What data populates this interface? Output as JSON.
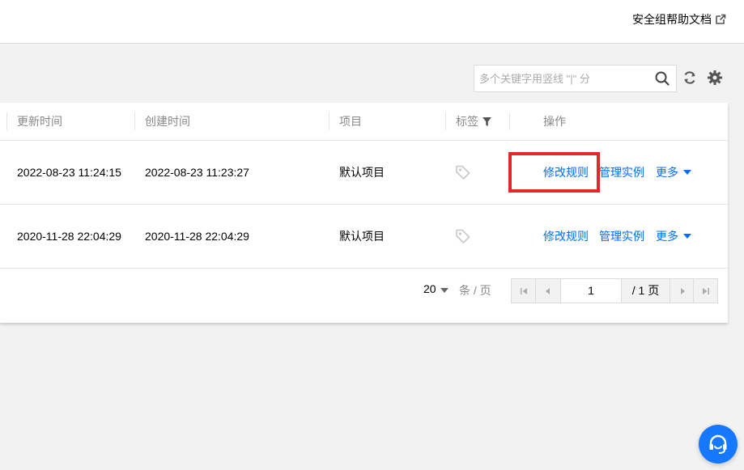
{
  "header": {
    "help_link": "安全组帮助文档"
  },
  "toolbar": {
    "search_placeholder": "多个关键字用竖线 \"|\" 分",
    "icons": [
      "search-icon",
      "refresh-icon",
      "settings-icon"
    ]
  },
  "table": {
    "columns": [
      "更新时间",
      "创建时间",
      "项目",
      "标签",
      "操作"
    ],
    "rows": [
      {
        "updated": "2022-08-23 11:24:15",
        "created": "2022-08-23 11:23:27",
        "project": "默认项目",
        "actions": [
          "修改规则",
          "管理实例",
          "更多"
        ]
      },
      {
        "updated": "2020-11-28 22:04:29",
        "created": "2020-11-28 22:04:29",
        "project": "默认项目",
        "actions": [
          "修改规则",
          "管理实例",
          "更多"
        ]
      }
    ]
  },
  "pagination": {
    "page_size": "20",
    "unit": "条 / 页",
    "current_page": "1",
    "total": "/ 1 页"
  },
  "colors": {
    "link": "#006eff",
    "highlight": "#e02a2a",
    "support": "#1677ff"
  }
}
